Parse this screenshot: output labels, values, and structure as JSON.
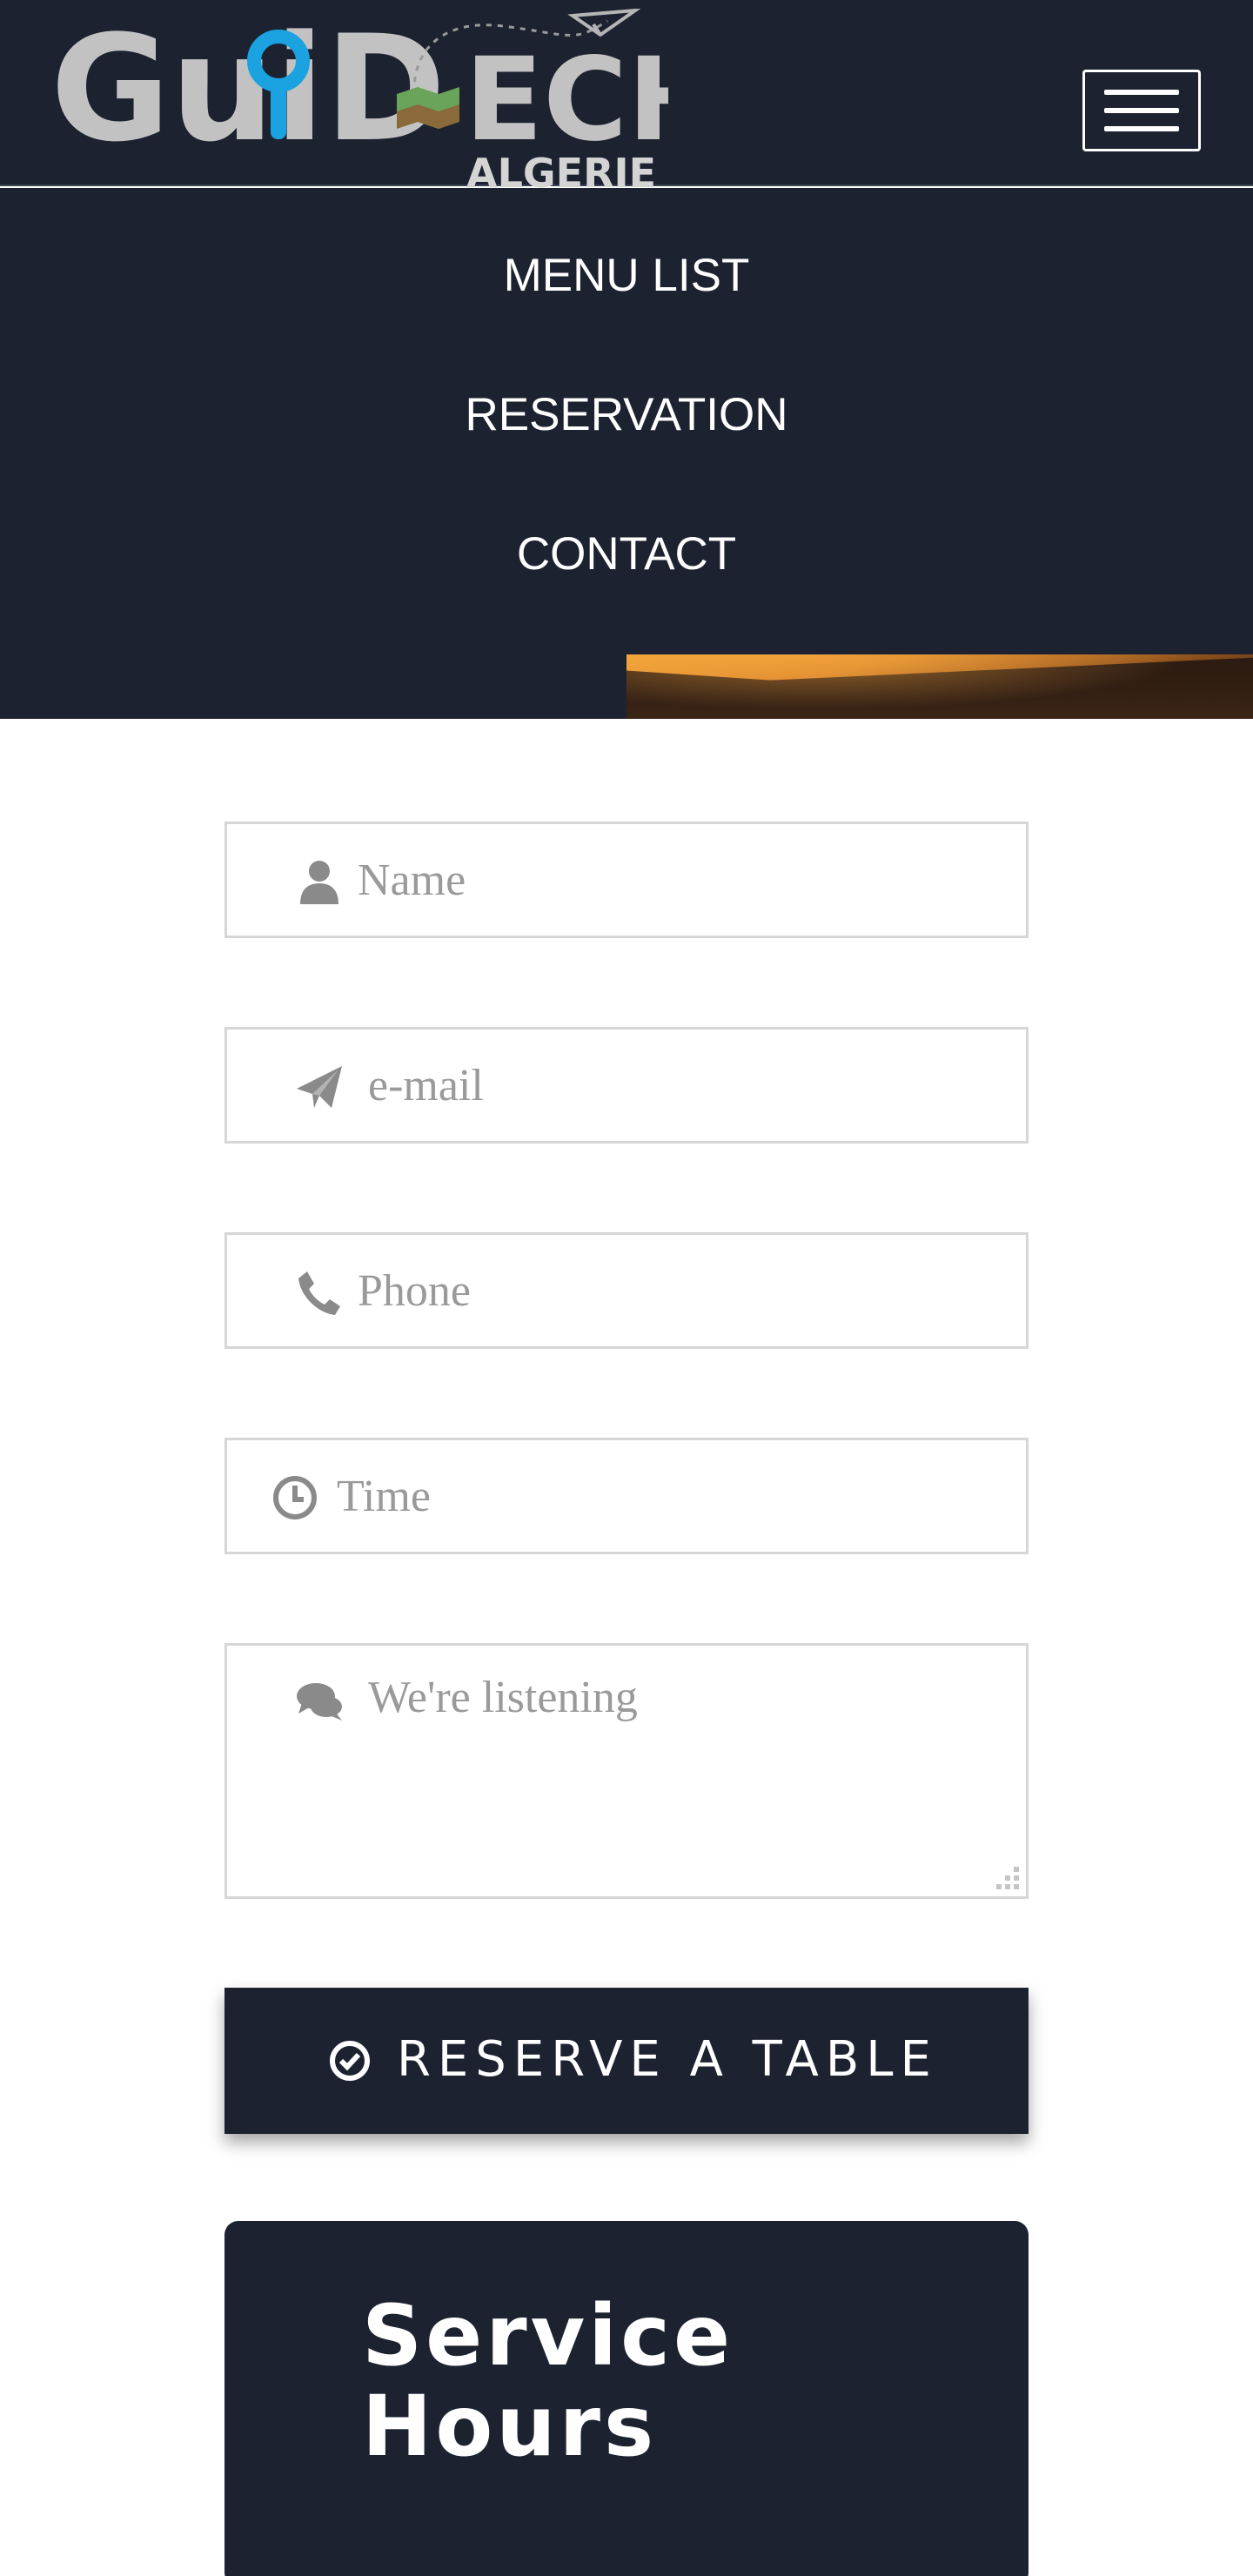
{
  "header": {
    "logo": {
      "word": "GuiD",
      "word_end": "ECH",
      "sub": "ALGERIE",
      "accent_color": "#1aa3e0"
    },
    "menu_toggle_icon": "hamburger-icon"
  },
  "nav": {
    "items": [
      {
        "label": "MENU LIST"
      },
      {
        "label": "RESERVATION"
      },
      {
        "label": "CONTACT"
      }
    ]
  },
  "form": {
    "name": {
      "placeholder": "Name",
      "icon": "user-icon"
    },
    "email": {
      "placeholder": "e-mail",
      "icon": "paper-plane-icon"
    },
    "phone": {
      "placeholder": "Phone",
      "icon": "phone-icon"
    },
    "time": {
      "placeholder": "Time",
      "icon": "clock-icon"
    },
    "message": {
      "placeholder": "We're listening",
      "icon": "comments-icon"
    },
    "submit": {
      "label": "RESERVE A TABLE",
      "icon": "check-circle-icon"
    }
  },
  "hours": {
    "title": "Service Hours"
  },
  "colors": {
    "navy": "#1c2230",
    "field_border": "#d6d6d6",
    "placeholder": "#9a9a9a",
    "icon_gray": "#8a8a8a"
  }
}
